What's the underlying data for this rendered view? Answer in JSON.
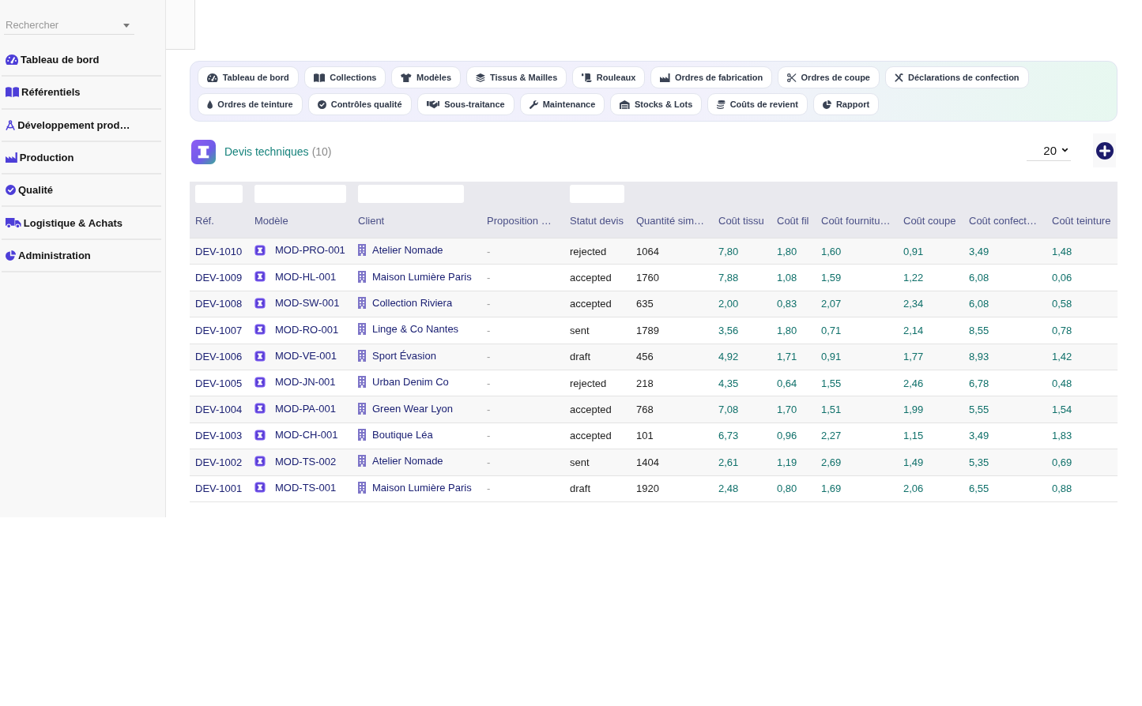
{
  "search": {
    "placeholder": "Rechercher"
  },
  "sidebar": {
    "items": [
      "Tableau de bord",
      "Référentiels",
      "Développement prod…",
      "Production",
      "Qualité",
      "Logistique & Achats",
      "Administration"
    ]
  },
  "module_nav": {
    "rows": [
      [
        "Tableau de bord",
        "Collections",
        "Modèles",
        "Tissus & Mailles",
        "Rouleaux",
        "Ordres de fabrication",
        "Ordres de coupe",
        "Déclarations de confection"
      ],
      [
        "Ordres de teinture",
        "Contrôles qualité",
        "Sous-traitance",
        "Maintenance",
        "Stocks & Lots",
        "Coûts de revient",
        "Rapport"
      ]
    ]
  },
  "list": {
    "title": "Devis techniques",
    "count": "(10)",
    "page_size": "20"
  },
  "table": {
    "columns": [
      {
        "label": "Réf.",
        "filter": true,
        "kind": "link"
      },
      {
        "label": "Modèle",
        "filter": true,
        "kind": "model"
      },
      {
        "label": "Client",
        "filter": true,
        "kind": "client"
      },
      {
        "label": "Proposition …",
        "filter": false,
        "kind": "muted"
      },
      {
        "label": "Statut devis",
        "filter": true,
        "kind": "status"
      },
      {
        "label": "Quantité sim…",
        "filter": false,
        "kind": "number"
      },
      {
        "label": "Coût tissu",
        "filter": false,
        "kind": "money"
      },
      {
        "label": "Coût fil",
        "filter": false,
        "kind": "money"
      },
      {
        "label": "Coût fournitu…",
        "filter": false,
        "kind": "money"
      },
      {
        "label": "Coût coupe",
        "filter": false,
        "kind": "money"
      },
      {
        "label": "Coût confect…",
        "filter": false,
        "kind": "money"
      },
      {
        "label": "Coût teinture",
        "filter": false,
        "kind": "money"
      }
    ],
    "rows": [
      {
        "cells": [
          "DEV-1010",
          "MOD-PRO-001",
          "Atelier Nomade",
          "-",
          "rejected",
          "1064",
          "7,80",
          "1,80",
          "1,60",
          "0,91",
          "3,49",
          "1,48"
        ]
      },
      {
        "cells": [
          "DEV-1009",
          "MOD-HL-001",
          "Maison Lumière Paris",
          "-",
          "accepted",
          "1760",
          "7,88",
          "1,08",
          "1,59",
          "1,22",
          "6,08",
          "0,06"
        ]
      },
      {
        "cells": [
          "DEV-1008",
          "MOD-SW-001",
          "Collection Riviera",
          "-",
          "accepted",
          "635",
          "2,00",
          "0,83",
          "2,07",
          "2,34",
          "6,08",
          "0,58"
        ]
      },
      {
        "cells": [
          "DEV-1007",
          "MOD-RO-001",
          "Linge & Co Nantes",
          "-",
          "sent",
          "1789",
          "3,56",
          "1,80",
          "0,71",
          "2,14",
          "8,55",
          "0,78"
        ]
      },
      {
        "cells": [
          "DEV-1006",
          "MOD-VE-001",
          "Sport Évasion",
          "-",
          "draft",
          "456",
          "4,92",
          "1,71",
          "0,91",
          "1,77",
          "8,93",
          "1,42"
        ]
      },
      {
        "cells": [
          "DEV-1005",
          "MOD-JN-001",
          "Urban Denim Co",
          "-",
          "rejected",
          "218",
          "4,35",
          "0,64",
          "1,55",
          "2,46",
          "6,78",
          "0,48"
        ]
      },
      {
        "cells": [
          "DEV-1004",
          "MOD-PA-001",
          "Green Wear Lyon",
          "-",
          "accepted",
          "768",
          "7,08",
          "1,70",
          "1,51",
          "1,99",
          "5,55",
          "1,54"
        ]
      },
      {
        "cells": [
          "DEV-1003",
          "MOD-CH-001",
          "Boutique Léa",
          "-",
          "accepted",
          "101",
          "6,73",
          "0,96",
          "2,27",
          "1,15",
          "3,49",
          "1,83"
        ]
      },
      {
        "cells": [
          "DEV-1002",
          "MOD-TS-002",
          "Atelier Nomade",
          "-",
          "sent",
          "1404",
          "2,61",
          "1,19",
          "2,69",
          "1,49",
          "5,35",
          "0,69"
        ]
      },
      {
        "cells": [
          "DEV-1001",
          "MOD-TS-001",
          "Maison Lumière Paris",
          "-",
          "draft",
          "1920",
          "2,48",
          "0,80",
          "1,69",
          "2,06",
          "6,55",
          "0,88"
        ]
      }
    ]
  }
}
